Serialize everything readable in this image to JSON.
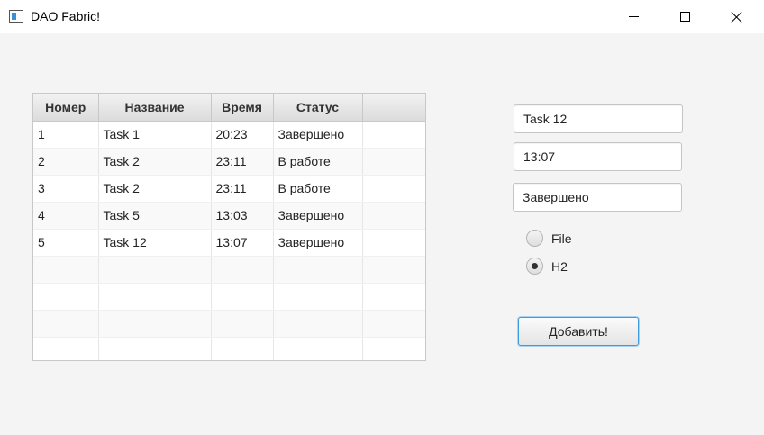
{
  "window": {
    "title": "DAO Fabric!"
  },
  "table": {
    "columns": [
      "Номер",
      "Название",
      "Время",
      "Статус",
      ""
    ],
    "rows": [
      [
        "1",
        "Task 1",
        "20:23",
        "Завершено",
        ""
      ],
      [
        "2",
        "Task 2",
        "23:11",
        "В работе",
        ""
      ],
      [
        "3",
        "Task 2",
        "23:11",
        "В работе",
        ""
      ],
      [
        "4",
        "Task 5",
        "13:03",
        "Завершено",
        ""
      ],
      [
        "5",
        "Task 12",
        "13:07",
        "Завершено",
        ""
      ],
      [
        "",
        "",
        "",
        "",
        ""
      ],
      [
        "",
        "",
        "",
        "",
        ""
      ],
      [
        "",
        "",
        "",
        "",
        ""
      ],
      [
        "",
        "",
        "",
        "",
        ""
      ]
    ]
  },
  "form": {
    "name_value": "Task 12",
    "time_value": "13:07",
    "status_value": "Завершено",
    "radio_file_label": "File",
    "radio_h2_label": "H2",
    "selected_storage": "H2",
    "add_button_label": "Добавить!"
  }
}
